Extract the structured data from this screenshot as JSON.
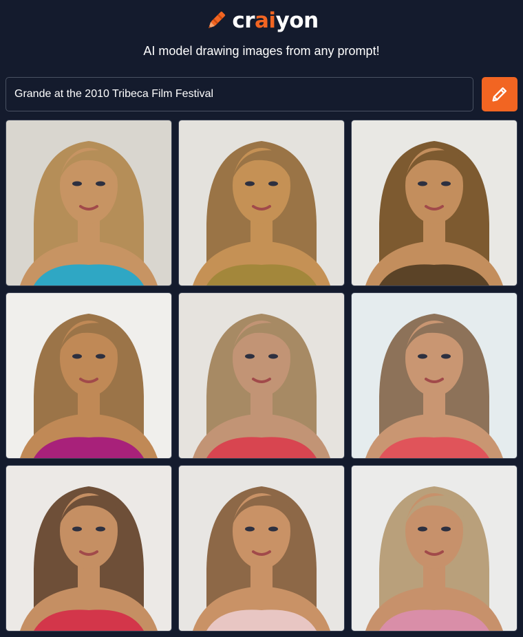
{
  "brand": {
    "name_prefix": "cr",
    "name_accent": "ai",
    "name_suffix": "yon",
    "accent_color": "#f26522",
    "logo_icon": "crayon-icon"
  },
  "tagline": "AI model drawing images from any prompt!",
  "search": {
    "value": "Grande at the 2010 Tribeca Film Festival",
    "button_icon": "pencil-icon"
  },
  "results": [
    {
      "bg": "#d9d6cf",
      "hair": "#b58e58",
      "skin": "#c79463",
      "outfit": "#2fa7c4"
    },
    {
      "bg": "#e4e2dd",
      "hair": "#9a7446",
      "skin": "#c59155",
      "outfit": "#a3873b"
    },
    {
      "bg": "#e9e8e4",
      "hair": "#7d5a30",
      "skin": "#c38e5d",
      "outfit": "#5b4327"
    },
    {
      "bg": "#f0efec",
      "hair": "#9b7448",
      "skin": "#c08956",
      "outfit": "#a8217a"
    },
    {
      "bg": "#e6e3de",
      "hair": "#a78a64",
      "skin": "#c29475",
      "outfit": "#d84550"
    },
    {
      "bg": "#e5ecee",
      "hair": "#8d7259",
      "skin": "#c99672",
      "outfit": "#e0545a"
    },
    {
      "bg": "#ece9e6",
      "hair": "#6e4f38",
      "skin": "#c58f63",
      "outfit": "#d3364a"
    },
    {
      "bg": "#e8e6e3",
      "hair": "#8d6847",
      "skin": "#c99266",
      "outfit": "#e8c6c3"
    },
    {
      "bg": "#ebebea",
      "hair": "#b9a07b",
      "skin": "#c7916b",
      "outfit": "#d98ea8"
    }
  ]
}
